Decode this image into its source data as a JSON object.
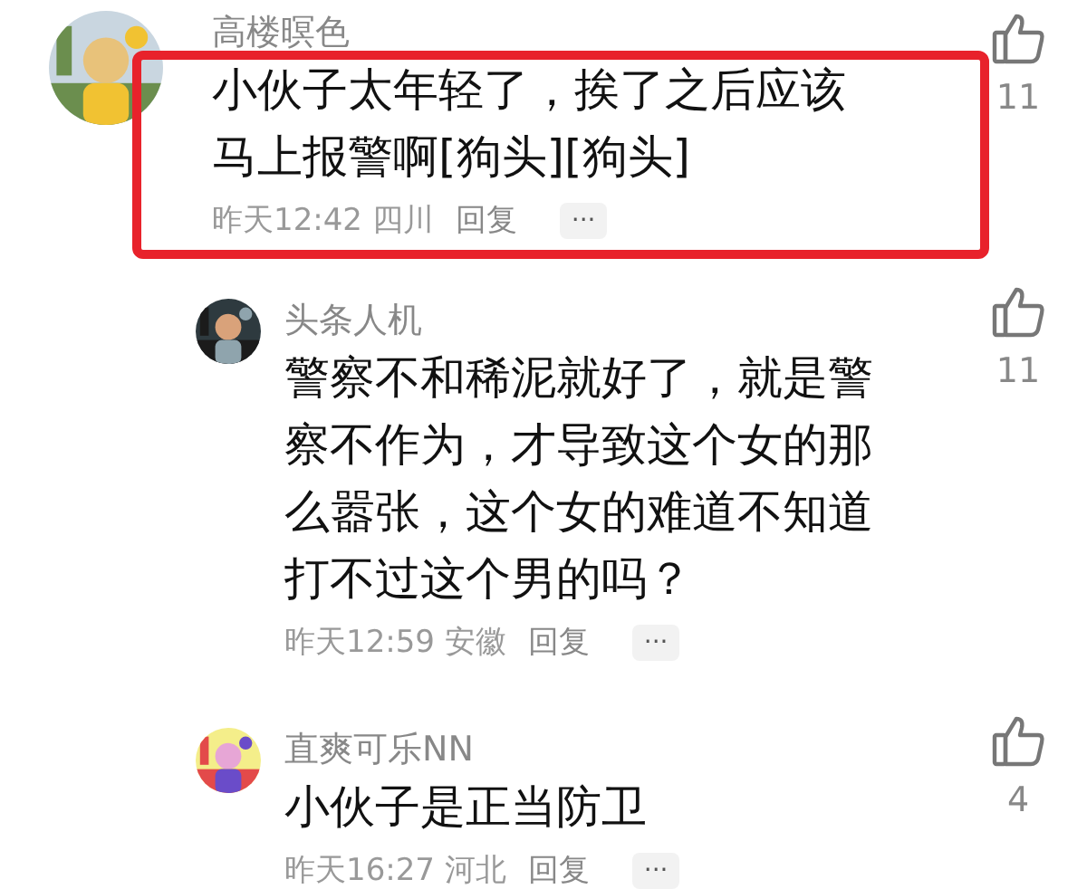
{
  "comments": [
    {
      "kind": "top",
      "highlighted": true,
      "author": "高楼暝色",
      "text": "小伙子太年轻了，挨了之后应该马上报警啊[狗头][狗头]",
      "time_place": "昨天12:42 四川",
      "reply": "回复",
      "more": "···",
      "likes": "11"
    },
    {
      "kind": "reply",
      "highlighted": false,
      "author": "头条人机",
      "text": "警察不和稀泥就好了，就是警察不作为，才导致这个女的那么嚣张，这个女的难道不知道打不过这个男的吗？",
      "time_place": "昨天12:59 安徽",
      "reply": "回复",
      "more": "···",
      "likes": "11"
    },
    {
      "kind": "reply",
      "highlighted": false,
      "author": "直爽可乐NN",
      "text": "小伙子是正当防卫",
      "time_place": "昨天16:27 河北",
      "reply": "回复",
      "more": "···",
      "likes": "4"
    }
  ]
}
